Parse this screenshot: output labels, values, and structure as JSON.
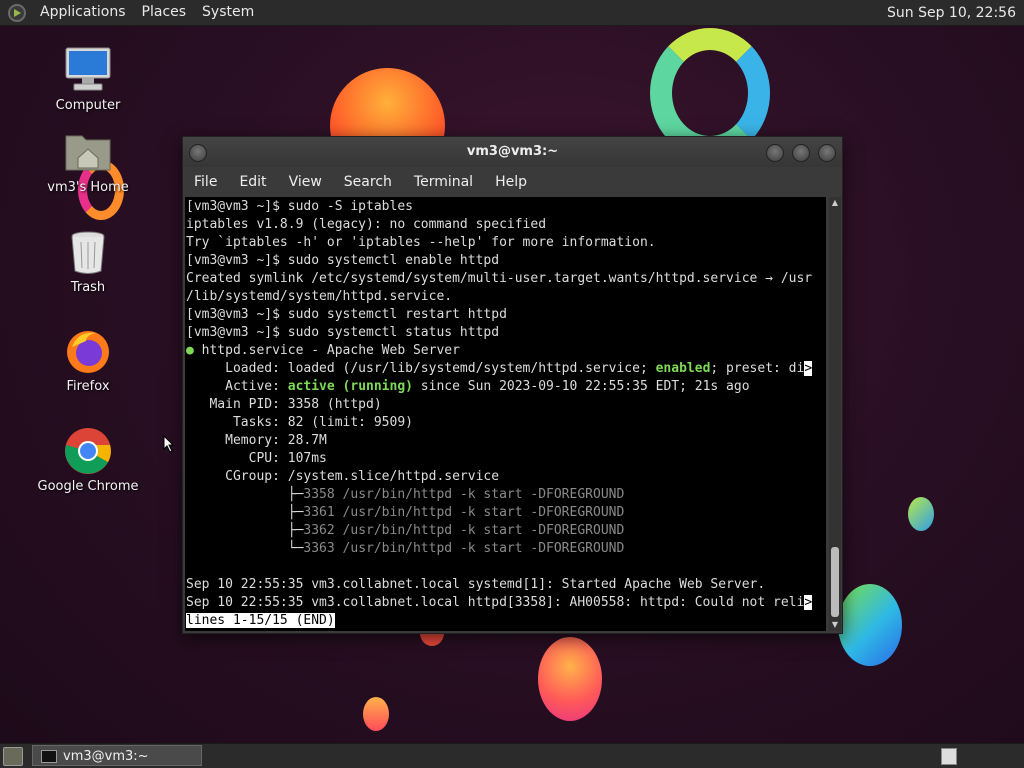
{
  "top_panel": {
    "menus": [
      "Applications",
      "Places",
      "System"
    ],
    "clock": "Sun Sep 10, 22:56"
  },
  "desktop_icons": [
    {
      "label": "Computer",
      "icon": "computer-icon"
    },
    {
      "label": "vm3's Home",
      "icon": "home-folder-icon"
    },
    {
      "label": "Trash",
      "icon": "trash-icon"
    },
    {
      "label": "Firefox",
      "icon": "firefox-icon"
    },
    {
      "label": "Google Chrome",
      "icon": "chrome-icon"
    }
  ],
  "terminal": {
    "title": "vm3@vm3:~",
    "menu": [
      "File",
      "Edit",
      "View",
      "Search",
      "Terminal",
      "Help"
    ],
    "lines": [
      "[vm3@vm3 ~]$ sudo -S iptables",
      "iptables v1.8.9 (legacy): no command specified",
      "Try `iptables -h' or 'iptables --help' for more information.",
      "[vm3@vm3 ~]$ sudo systemctl enable httpd",
      "Created symlink /etc/systemd/system/multi-user.target.wants/httpd.service → /usr",
      "/lib/systemd/system/httpd.service.",
      "[vm3@vm3 ~]$ sudo systemctl restart httpd",
      "[vm3@vm3 ~]$ sudo systemctl status httpd",
      "● httpd.service - Apache Web Server",
      "     Loaded: loaded (/usr/lib/systemd/system/httpd.service; enabled; preset: di>",
      "     Active: active (running) since Sun 2023-09-10 22:55:35 EDT; 21s ago",
      "   Main PID: 3358 (httpd)",
      "      Tasks: 82 (limit: 9509)",
      "     Memory: 28.7M",
      "        CPU: 107ms",
      "     CGroup: /system.slice/httpd.service",
      "             ├─3358 /usr/bin/httpd -k start -DFOREGROUND",
      "             ├─3361 /usr/bin/httpd -k start -DFOREGROUND",
      "             ├─3362 /usr/bin/httpd -k start -DFOREGROUND",
      "             └─3363 /usr/bin/httpd -k start -DFOREGROUND",
      "",
      "Sep 10 22:55:35 vm3.collabnet.local systemd[1]: Started Apache Web Server.",
      "Sep 10 22:55:35 vm3.collabnet.local httpd[3358]: AH00558: httpd: Could not reli>",
      "lines 1-15/15 (END)"
    ],
    "colors": {
      "highlight_green": "#7ed957",
      "background": "#000000",
      "foreground": "#dcdcdc"
    }
  },
  "bottom_panel": {
    "task_label": "vm3@vm3:~"
  }
}
